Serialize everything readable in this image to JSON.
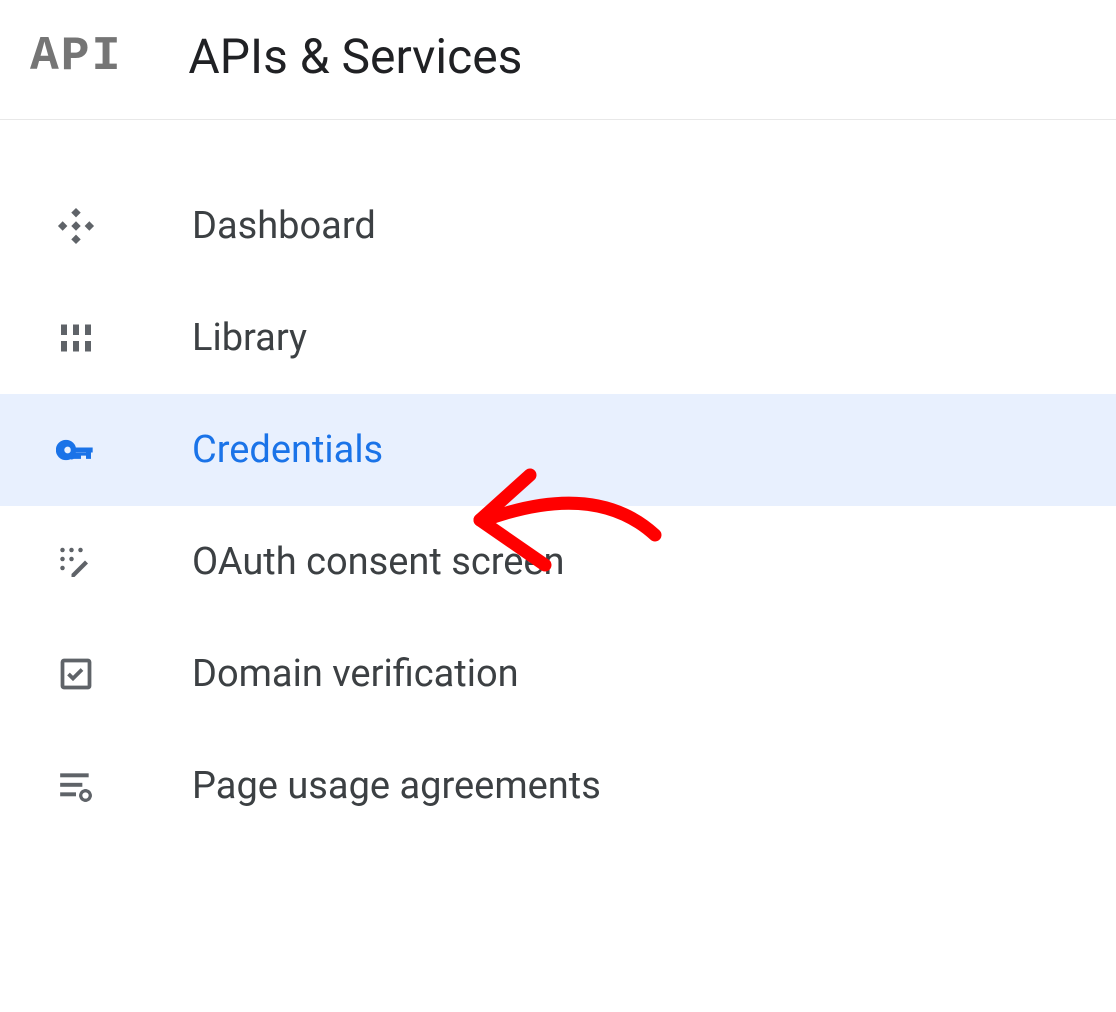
{
  "header": {
    "logo": "API",
    "title": "APIs & Services"
  },
  "nav": {
    "items": [
      {
        "label": "Dashboard",
        "icon": "api-dashboard",
        "selected": false
      },
      {
        "label": "Library",
        "icon": "library",
        "selected": false
      },
      {
        "label": "Credentials",
        "icon": "key",
        "selected": true
      },
      {
        "label": "OAuth consent screen",
        "icon": "oauth-consent",
        "selected": false
      },
      {
        "label": "Domain verification",
        "icon": "check-box",
        "selected": false
      },
      {
        "label": "Page usage agreements",
        "icon": "page-settings",
        "selected": false
      }
    ]
  },
  "colors": {
    "selectedBg": "#e8f0fe",
    "selectedText": "#1a73e8",
    "iconGrey": "#5f6368",
    "textGrey": "#3c4043",
    "annotationRed": "#ff0000"
  }
}
